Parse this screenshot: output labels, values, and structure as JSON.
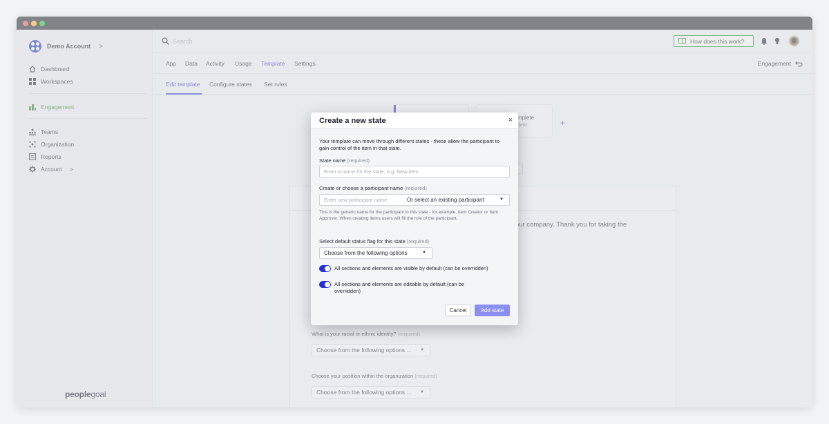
{
  "sidebar": {
    "account_name": "Demo Account",
    "account_chevron": ">",
    "items": [
      {
        "label": "Dashboard",
        "icon": "home-icon"
      },
      {
        "label": "Workspaces",
        "icon": "grid-icon"
      },
      {
        "label": "Engagement",
        "icon": "engagement-icon"
      },
      {
        "label": "Teams",
        "icon": "teams-icon"
      },
      {
        "label": "Organization",
        "icon": "organization-icon"
      },
      {
        "label": "Reports",
        "icon": "reports-icon"
      },
      {
        "label": "Account",
        "icon": "gear-icon"
      }
    ],
    "account_item_chevron": ">",
    "brand_bold": "people",
    "brand_light": "goal",
    "accent_color": "#3c8a2e"
  },
  "topbar": {
    "search_placeholder": "Search",
    "how_label": "How does this work?",
    "icons": [
      "bell-icon",
      "lightbulb-icon"
    ]
  },
  "nav": {
    "tabs": [
      "App",
      "Data",
      "Activity",
      "Usage",
      "Template",
      "Settings"
    ],
    "active_tab": "Template",
    "right_label": "Engagement",
    "accent_color": "#3a3fc6"
  },
  "subnav": {
    "tabs": [
      "Edit template",
      "Configure states",
      "Set rules"
    ],
    "active_tab": "Edit template"
  },
  "background": {
    "card_title": "mplete",
    "card_sub": "dent",
    "card_badge": "ta",
    "plus": "+",
    "intro_text": "d our company. Thank you for taking the",
    "questions": [
      {
        "label": "What is your racial or ethnic identity?",
        "req": "(required)",
        "select": "Choose from the following options ..."
      },
      {
        "label": "Choose your position within the organization",
        "req": "(required)",
        "select": "Choose from the following options ..."
      }
    ]
  },
  "modal": {
    "title": "Create a new state",
    "close": "×",
    "description": "Your template can move through different states - these allow the participant to gain control of the item in that state.",
    "state_name_label": "State name",
    "state_name_req": "(required)",
    "state_name_placeholder": "Enter a name for the state, e.g. New item",
    "participant_label": "Create or choose a participant name",
    "participant_req": "(required)",
    "participant_placeholder": "Enter new participant name",
    "participant_select": "Or select an existing participant",
    "participant_help": "This is the generic name for the participant in this state - for example, Item Creator or Item Approver. When creating items users will fill the role of the participant.",
    "status_label": "Select default status flag for this state",
    "status_req": "(required)",
    "status_select": "Choose from the following options",
    "toggle_visible": "All sections and elements are visible by default (can be overridden)",
    "toggle_editable": "All sections and elements are editable by default (can be overridden)",
    "toggle_visible_on": true,
    "toggle_editable_on": true,
    "cancel_label": "Cancel",
    "add_label": "Add state",
    "primary_color": "#8b8ff2",
    "toggle_color": "#2230d8"
  }
}
